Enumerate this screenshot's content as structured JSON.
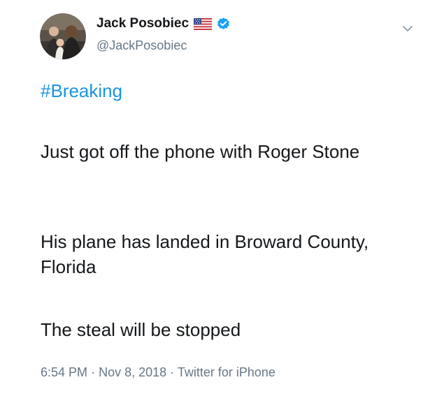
{
  "author": {
    "display_name": "Jack Posobiec",
    "handle": "@JackPosobiec",
    "avatar_icon": "profile-photo",
    "flag_icon": "us-flag-emoji",
    "verified_icon": "verified-badge",
    "verified_color": "#1da1f2"
  },
  "menu": {
    "caret_icon": "chevron-down-icon"
  },
  "tweet": {
    "hashtag": "#Breaking",
    "paragraphs": [
      "Just got off the phone with Roger Stone",
      "His plane has landed in Broward County, Florida",
      "The steal will be stopped"
    ]
  },
  "meta": {
    "time": "6:54 PM",
    "separator": "·",
    "date": "Nov 8, 2018",
    "source": "Twitter for iPhone"
  },
  "colors": {
    "text": "#14171a",
    "secondary": "#657786",
    "link": "#1b95e0"
  }
}
